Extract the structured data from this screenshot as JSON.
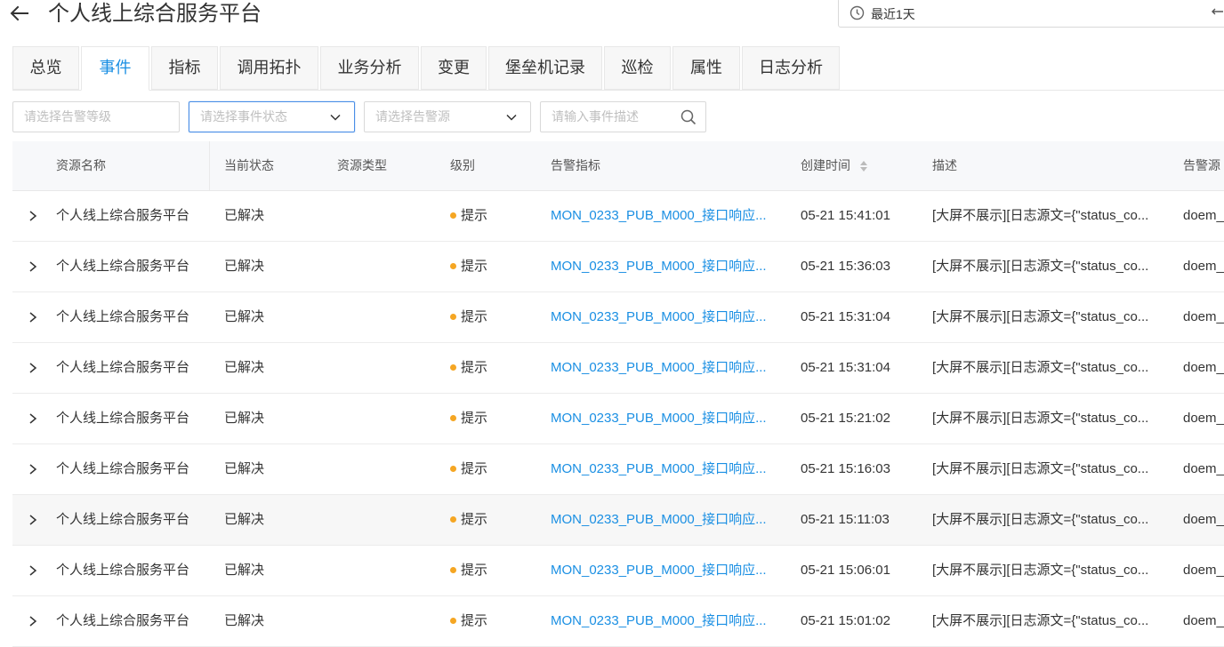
{
  "header": {
    "title": "个人线上综合服务平台",
    "back_icon": "arrow-left-icon",
    "time_range": "最近1天"
  },
  "tabs": [
    {
      "label": "总览",
      "active": false
    },
    {
      "label": "事件",
      "active": true
    },
    {
      "label": "指标",
      "active": false
    },
    {
      "label": "调用拓扑",
      "active": false
    },
    {
      "label": "业务分析",
      "active": false
    },
    {
      "label": "变更",
      "active": false
    },
    {
      "label": "堡垒机记录",
      "active": false
    },
    {
      "label": "巡检",
      "active": false
    },
    {
      "label": "属性",
      "active": false
    },
    {
      "label": "日志分析",
      "active": false
    }
  ],
  "filters": {
    "alert_level_placeholder": "请选择告警等级",
    "event_status_placeholder": "请选择事件状态",
    "alert_source_placeholder": "请选择告警源",
    "description_placeholder": "请输入事件描述"
  },
  "table": {
    "columns": {
      "resource_name": "资源名称",
      "status": "当前状态",
      "resource_type": "资源类型",
      "level": "级别",
      "metric": "告警指标",
      "created": "创建时间",
      "description": "描述",
      "source": "告警源"
    },
    "rows": [
      {
        "resource": "个人线上综合服务平台",
        "status": "已解决",
        "type": "",
        "level": "提示",
        "metric": "MON_0233_PUB_M000_接口响应...",
        "created": "05-21 15:41:01",
        "desc": "[大屏不展示][日志源文={\"status_co...",
        "source": "doem_"
      },
      {
        "resource": "个人线上综合服务平台",
        "status": "已解决",
        "type": "",
        "level": "提示",
        "metric": "MON_0233_PUB_M000_接口响应...",
        "created": "05-21 15:36:03",
        "desc": "[大屏不展示][日志源文={\"status_co...",
        "source": "doem_"
      },
      {
        "resource": "个人线上综合服务平台",
        "status": "已解决",
        "type": "",
        "level": "提示",
        "metric": "MON_0233_PUB_M000_接口响应...",
        "created": "05-21 15:31:04",
        "desc": "[大屏不展示][日志源文={\"status_co...",
        "source": "doem_"
      },
      {
        "resource": "个人线上综合服务平台",
        "status": "已解决",
        "type": "",
        "level": "提示",
        "metric": "MON_0233_PUB_M000_接口响应...",
        "created": "05-21 15:31:04",
        "desc": "[大屏不展示][日志源文={\"status_co...",
        "source": "doem_"
      },
      {
        "resource": "个人线上综合服务平台",
        "status": "已解决",
        "type": "",
        "level": "提示",
        "metric": "MON_0233_PUB_M000_接口响应...",
        "created": "05-21 15:21:02",
        "desc": "[大屏不展示][日志源文={\"status_co...",
        "source": "doem_"
      },
      {
        "resource": "个人线上综合服务平台",
        "status": "已解决",
        "type": "",
        "level": "提示",
        "metric": "MON_0233_PUB_M000_接口响应...",
        "created": "05-21 15:16:03",
        "desc": "[大屏不展示][日志源文={\"status_co...",
        "source": "doem_"
      },
      {
        "resource": "个人线上综合服务平台",
        "status": "已解决",
        "type": "",
        "level": "提示",
        "metric": "MON_0233_PUB_M000_接口响应...",
        "created": "05-21 15:11:03",
        "desc": "[大屏不展示][日志源文={\"status_co...",
        "source": "doem_"
      },
      {
        "resource": "个人线上综合服务平台",
        "status": "已解决",
        "type": "",
        "level": "提示",
        "metric": "MON_0233_PUB_M000_接口响应...",
        "created": "05-21 15:06:01",
        "desc": "[大屏不展示][日志源文={\"status_co...",
        "source": "doem_"
      },
      {
        "resource": "个人线上综合服务平台",
        "status": "已解决",
        "type": "",
        "level": "提示",
        "metric": "MON_0233_PUB_M000_接口响应...",
        "created": "05-21 15:01:02",
        "desc": "[大屏不展示][日志源文={\"status_co...",
        "source": "doem_"
      }
    ]
  },
  "colors": {
    "accent": "#1a8fe3",
    "level_dot": "#f5a623"
  }
}
